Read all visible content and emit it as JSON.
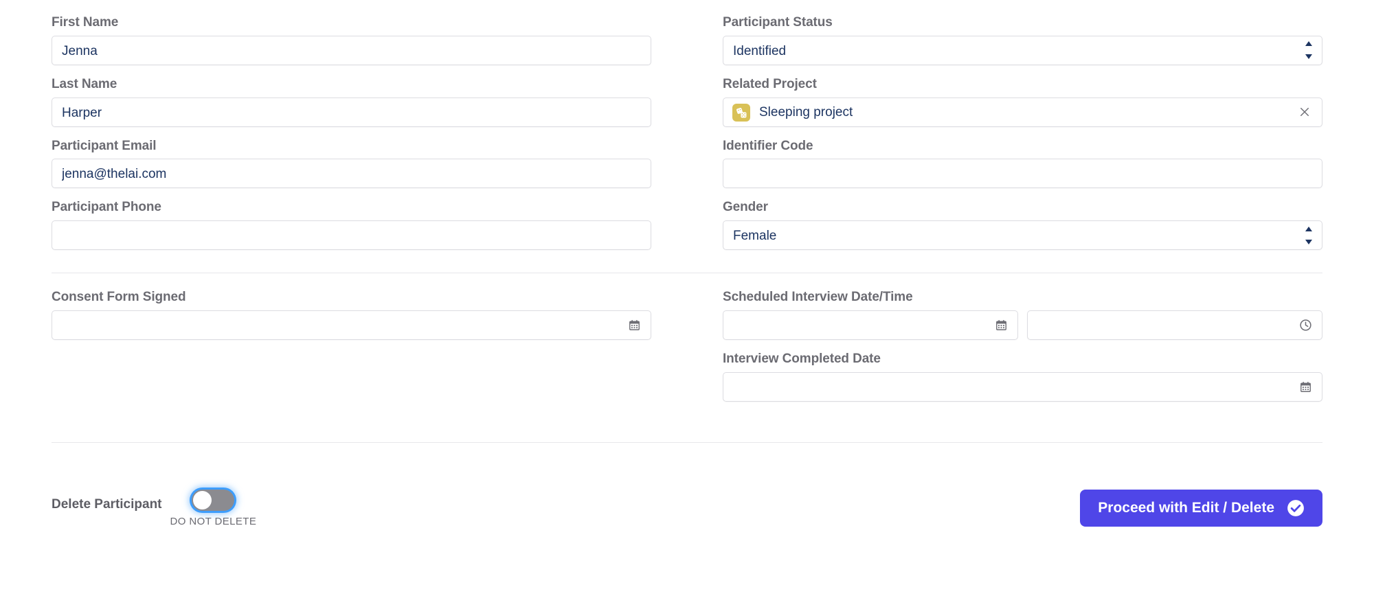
{
  "form": {
    "left_column": [
      {
        "label": "First Name",
        "value": "Jenna",
        "placeholder": "",
        "type": "text",
        "icon": ""
      },
      {
        "label": "Last Name",
        "value": "Harper",
        "placeholder": "",
        "type": "text",
        "icon": ""
      },
      {
        "label": "Participant Email",
        "value": "jenna@thelai.com",
        "placeholder": "",
        "type": "email",
        "icon": ""
      },
      {
        "label": "Participant Phone",
        "value": "",
        "placeholder": "",
        "type": "tel",
        "icon": ""
      }
    ],
    "right_column": [
      {
        "label": "Participant Status",
        "value": "Identified",
        "placeholder": "",
        "type": "select",
        "icon": "stepper-arrows-icon"
      },
      {
        "label": "Related Project",
        "value": "Sleeping project",
        "placeholder": "",
        "type": "reference",
        "icon": "dice-icon",
        "clear_icon": "close-icon"
      },
      {
        "label": "Identifier Code",
        "value": "",
        "placeholder": "",
        "type": "text",
        "icon": ""
      },
      {
        "label": "Gender",
        "value": "Female",
        "placeholder": "",
        "type": "select",
        "icon": "stepper-arrows-icon"
      }
    ],
    "date_section": {
      "left": [
        {
          "label": "Consent Form Signed",
          "value": "",
          "placeholder": "",
          "type": "date",
          "icon": "calendar-icon"
        }
      ],
      "right": [
        {
          "label": "Scheduled Interview Date/Time",
          "type": "datetime",
          "date": {
            "value": "",
            "placeholder": "",
            "icon": "calendar-icon"
          },
          "time": {
            "value": "",
            "placeholder": "",
            "icon": "clock-icon"
          }
        },
        {
          "label": "Interview Completed Date",
          "value": "",
          "placeholder": "",
          "type": "date",
          "icon": "calendar-icon"
        }
      ]
    }
  },
  "footer": {
    "delete_label": "Delete Participant",
    "toggle_state_caption": "DO NOT DELETE",
    "toggle_on": false,
    "submit_label": "Proceed with Edit / Delete",
    "submit_icon": "check-circle-icon"
  },
  "colors": {
    "accent_button": "#4F46E8",
    "input_text": "#1C3461",
    "label_text": "#6B6B72",
    "border": "#DCDCE1",
    "divider": "#E7E7EA",
    "project_icon_bg": "#D9C157",
    "toggle_off": "#8B8B90",
    "focus_ring": "#3D9DFC"
  }
}
